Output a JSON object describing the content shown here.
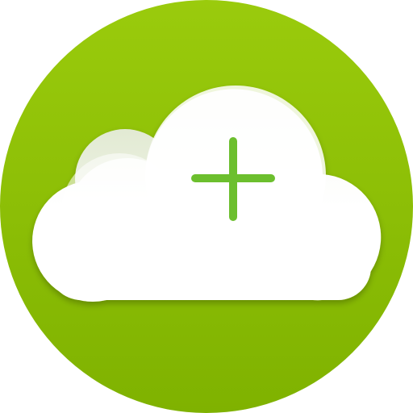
{
  "icon": {
    "name": "cloud-add-icon",
    "colors": {
      "circle_top": "#9acb0c",
      "circle_bottom": "#7fb200",
      "cloud_fill": "#ffffff",
      "cloud_shade": "#e6edd8",
      "plus": "#6cbf2e"
    }
  }
}
